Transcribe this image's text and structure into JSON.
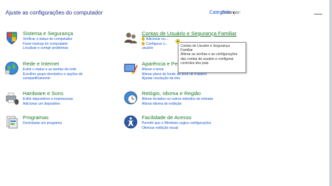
{
  "header": {
    "title": "Ajuste as configurações do computador",
    "view_by_label": "Exibir por:",
    "view_by_value": "Categoria"
  },
  "left_column": [
    {
      "title": "Sistema e Segurança",
      "icon": "shield-flag-icon",
      "links": [
        "Verificar o status do computador",
        "Fazer backup do computador",
        "Localizar e corrigir problemas"
      ]
    },
    {
      "title": "Rede e Internet",
      "icon": "globe-network-icon",
      "links": [
        "Exibir o status e as tarefas da rede",
        "Escolher grupo doméstico e opções de",
        "compartilhamento"
      ]
    },
    {
      "title": "Hardware e Sons",
      "icon": "printer-speaker-icon",
      "links": [
        "Exibir dispositivos e impressoras",
        "Adicionar um dispositivo"
      ]
    },
    {
      "title": "Programas",
      "icon": "programs-icon",
      "links": [
        "Desinstalar um programa"
      ]
    }
  ],
  "right_column": [
    {
      "title": "Contas de Usuário e Segurança Familiar",
      "icon": "users-icon",
      "links": [
        "Adicionar ou...",
        "Configurar o...",
        "usuário"
      ]
    },
    {
      "title": "Aparência e Personalização",
      "icon": "appearance-icon",
      "links": [
        "Alterar o tema",
        "Alterar plano de fundo da área de trabalho",
        "Ajustar resolução da tela"
      ]
    },
    {
      "title": "Relógio, Idioma e Região",
      "icon": "clock-globe-icon",
      "links": [
        "Alterar teclados ou outros métodos de entrada",
        "Alterar idioma de exibição"
      ]
    },
    {
      "title": "Facilidade de Acesso",
      "icon": "accessibility-icon",
      "links": [
        "Permitir que o Windows sugira configurações",
        "Otimizar exibição visual"
      ]
    }
  ],
  "tooltip": {
    "lines": [
      "Contas de Usuário e Segurança",
      "Familiar",
      "Alterar as senhas e as configurações",
      "das contas de usuário e configurar",
      "controles dos pais."
    ]
  },
  "colors": {
    "category_green": "#1e7a2e",
    "link_blue": "#1a59d1",
    "title_blue": "#1e3287",
    "shield_gold": "#e5b11b"
  }
}
